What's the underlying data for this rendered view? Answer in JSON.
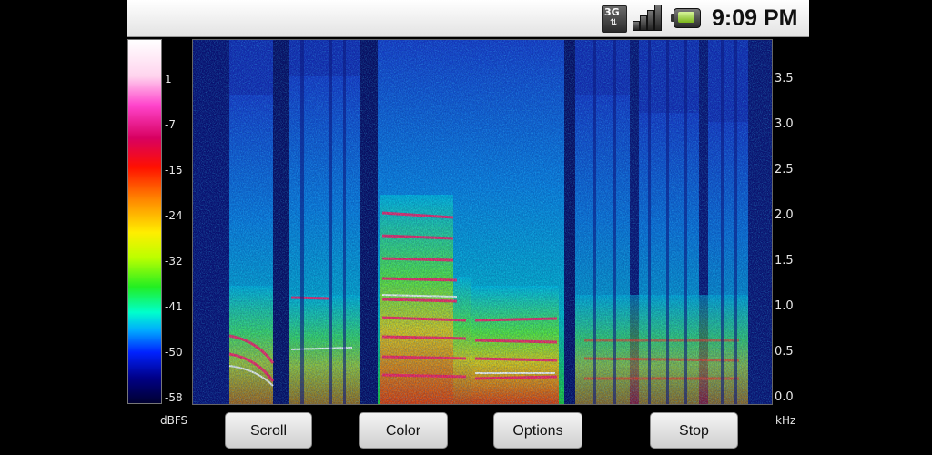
{
  "status_bar": {
    "network_label": "3G",
    "network_icon": "network-3g-icon",
    "signal_icon": "signal-bars-icon",
    "battery_icon": "battery-charging-icon",
    "time": "9:09 PM"
  },
  "colorbar": {
    "labels": [
      "1",
      "-7",
      "-15",
      "-24",
      "-32",
      "-41",
      "-50",
      "-58"
    ],
    "unit": "dBFS"
  },
  "frequency_axis": {
    "labels": [
      "3.5",
      "3.0",
      "2.5",
      "2.0",
      "1.5",
      "1.0",
      "0.5",
      "0.0"
    ],
    "unit": "kHz"
  },
  "buttons": {
    "scroll": "Scroll",
    "color": "Color",
    "options": "Options",
    "stop": "Stop"
  },
  "colors": {
    "background": "#000000",
    "status_bar": "#f0f0f0",
    "label_text": "#e6e6e6"
  }
}
